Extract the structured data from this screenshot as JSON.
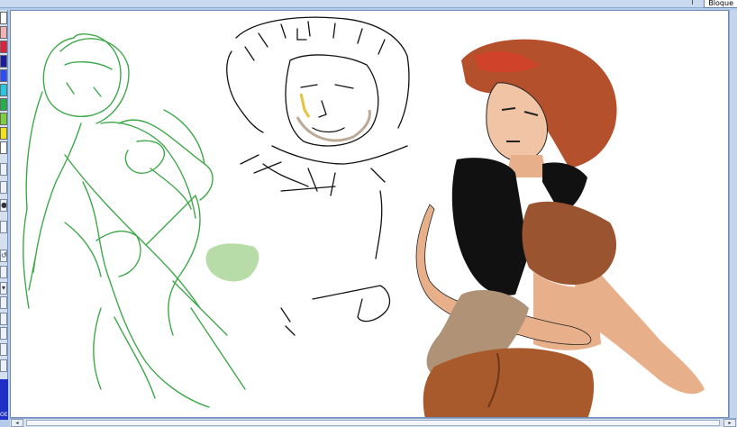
{
  "top_tab_label": "Bloque",
  "palette": {
    "colors": [
      "#ffffff",
      "#f2b3b3",
      "#e0203a",
      "#1a1aa0",
      "#2a4cff",
      "#20c8e0",
      "#23b04a",
      "#7ad23a",
      "#f2e21a",
      "#ffffff"
    ],
    "tools": [
      "",
      "",
      "●",
      "",
      "↺",
      "",
      "▾",
      "",
      "",
      "",
      "",
      ""
    ],
    "bottom_label": "OE"
  },
  "scrollbar": {
    "left_arrow": "◂",
    "right_arrow": "▸"
  },
  "colors": {
    "sketch_green": "#3fa84a",
    "ink_black": "#111111",
    "hair_red": "#b5502c",
    "skin": "#e8b08a",
    "top_brown": "#9a5430",
    "sleeve_tan": "#b09276",
    "blob_green": "#7dc060"
  }
}
